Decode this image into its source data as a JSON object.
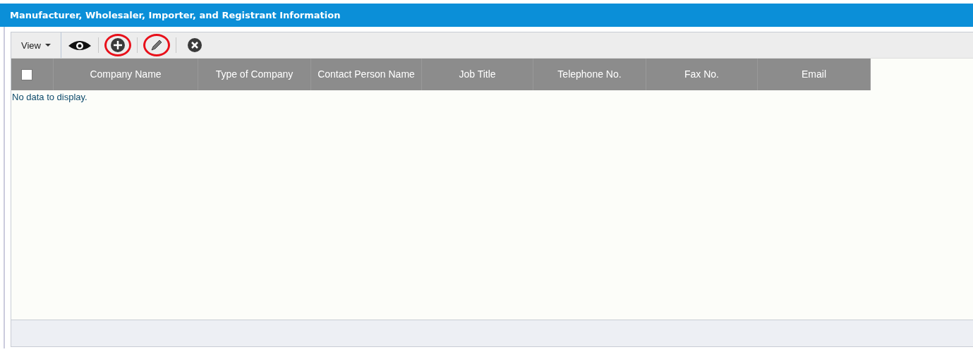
{
  "panel": {
    "title": "Manufacturer, Wholesaler, Importer, and Registrant Information"
  },
  "toolbar": {
    "view_menu": "View",
    "buttons": [
      {
        "kind": "view",
        "highlighted": false
      },
      {
        "kind": "add",
        "highlighted": true
      },
      {
        "kind": "edit",
        "highlighted": true
      },
      {
        "kind": "delete",
        "highlighted": false
      }
    ]
  },
  "table": {
    "select_all": {
      "checked": false
    },
    "columns": [
      "Company Name",
      "Type of Company",
      "Contact Person Name",
      "Job Title",
      "Telephone No.",
      "Fax No.",
      "Email"
    ],
    "empty_message": "No data to display."
  }
}
